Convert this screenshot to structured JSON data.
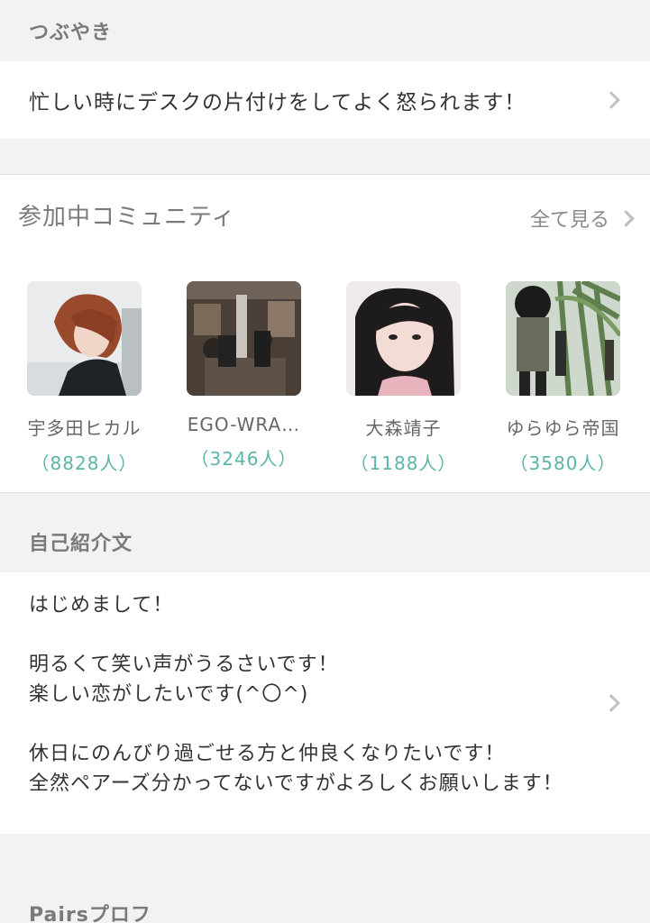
{
  "tweet": {
    "header": "つぶやき",
    "text": "忙しい時にデスクの片付けをしてよく怒られます！"
  },
  "community": {
    "title": "参加中コミュニティ",
    "see_all": "全て見る",
    "items": [
      {
        "name": "宇多田ヒカル",
        "count": "（8828人）"
      },
      {
        "name": "EGO-WRA…",
        "count": "（3246人）"
      },
      {
        "name": "大森靖子",
        "count": "（1188人）"
      },
      {
        "name": "ゆらゆら帝国",
        "count": "（3580人）"
      }
    ]
  },
  "intro": {
    "header": "自己紹介文",
    "text": "はじめまして！\n\n明るくて笑い声がうるさいです！\n楽しい恋がしたいです(^〇^)\n\n休日にのんびり過ごせる方と仲良くなりたいです！\n全然ペアーズ分かってないですがよろしくお願いします！"
  },
  "pairs": {
    "header": "Pairsプロフ"
  },
  "colors": {
    "accent": "#5bb5a8",
    "background": "#f2f2f2"
  }
}
